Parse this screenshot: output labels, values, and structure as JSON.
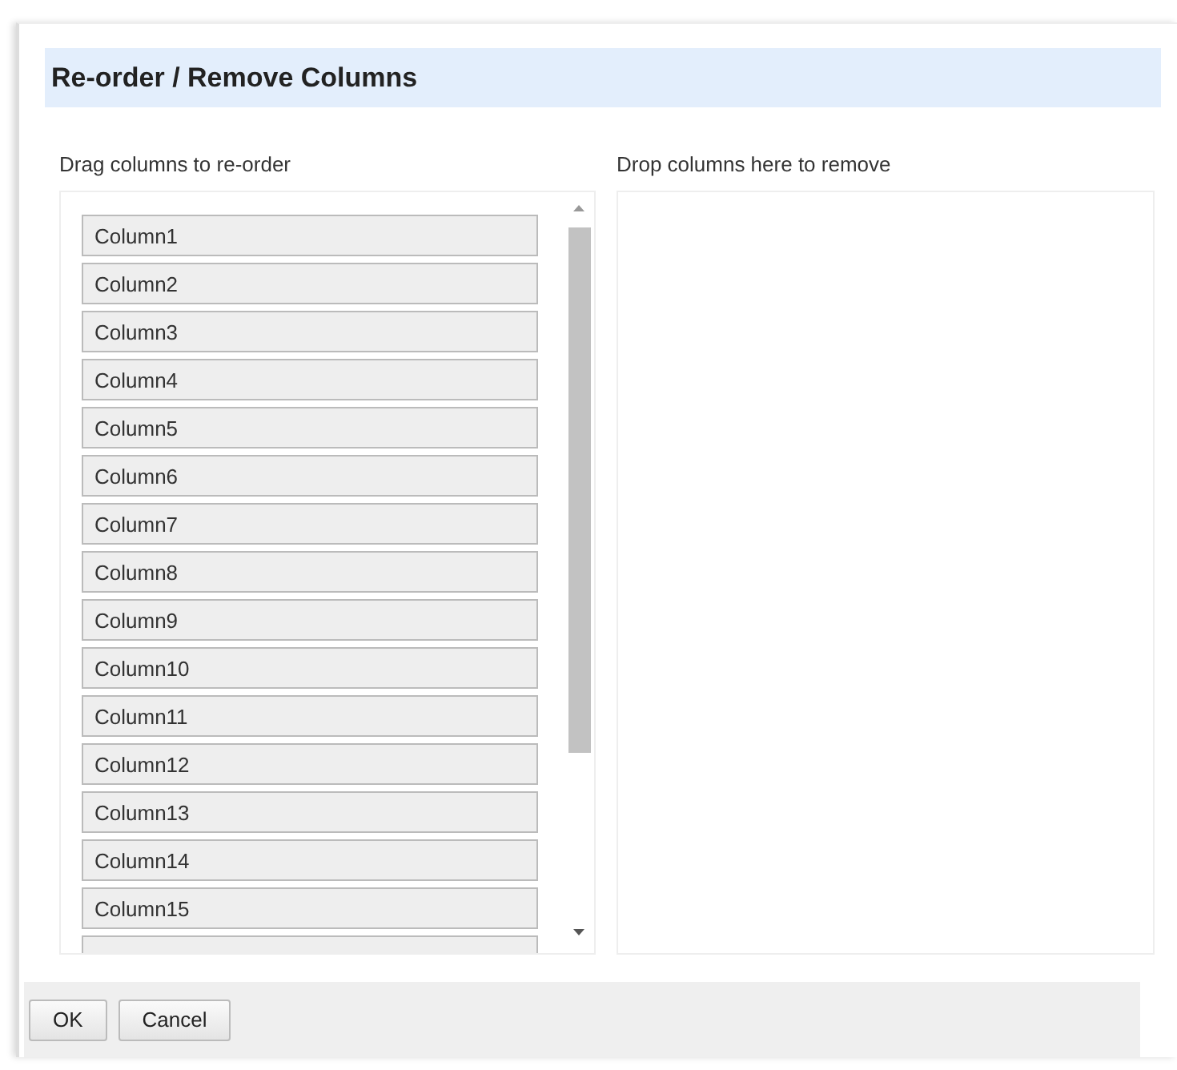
{
  "dialog": {
    "title": "Re-order / Remove Columns"
  },
  "reorder": {
    "label": "Drag columns to re-order",
    "items": [
      "Column1",
      "Column2",
      "Column3",
      "Column4",
      "Column5",
      "Column6",
      "Column7",
      "Column8",
      "Column9",
      "Column10",
      "Column11",
      "Column12",
      "Column13",
      "Column14",
      "Column15"
    ]
  },
  "remove": {
    "label": "Drop columns here to remove"
  },
  "buttons": [
    "OK",
    "Cancel"
  ]
}
